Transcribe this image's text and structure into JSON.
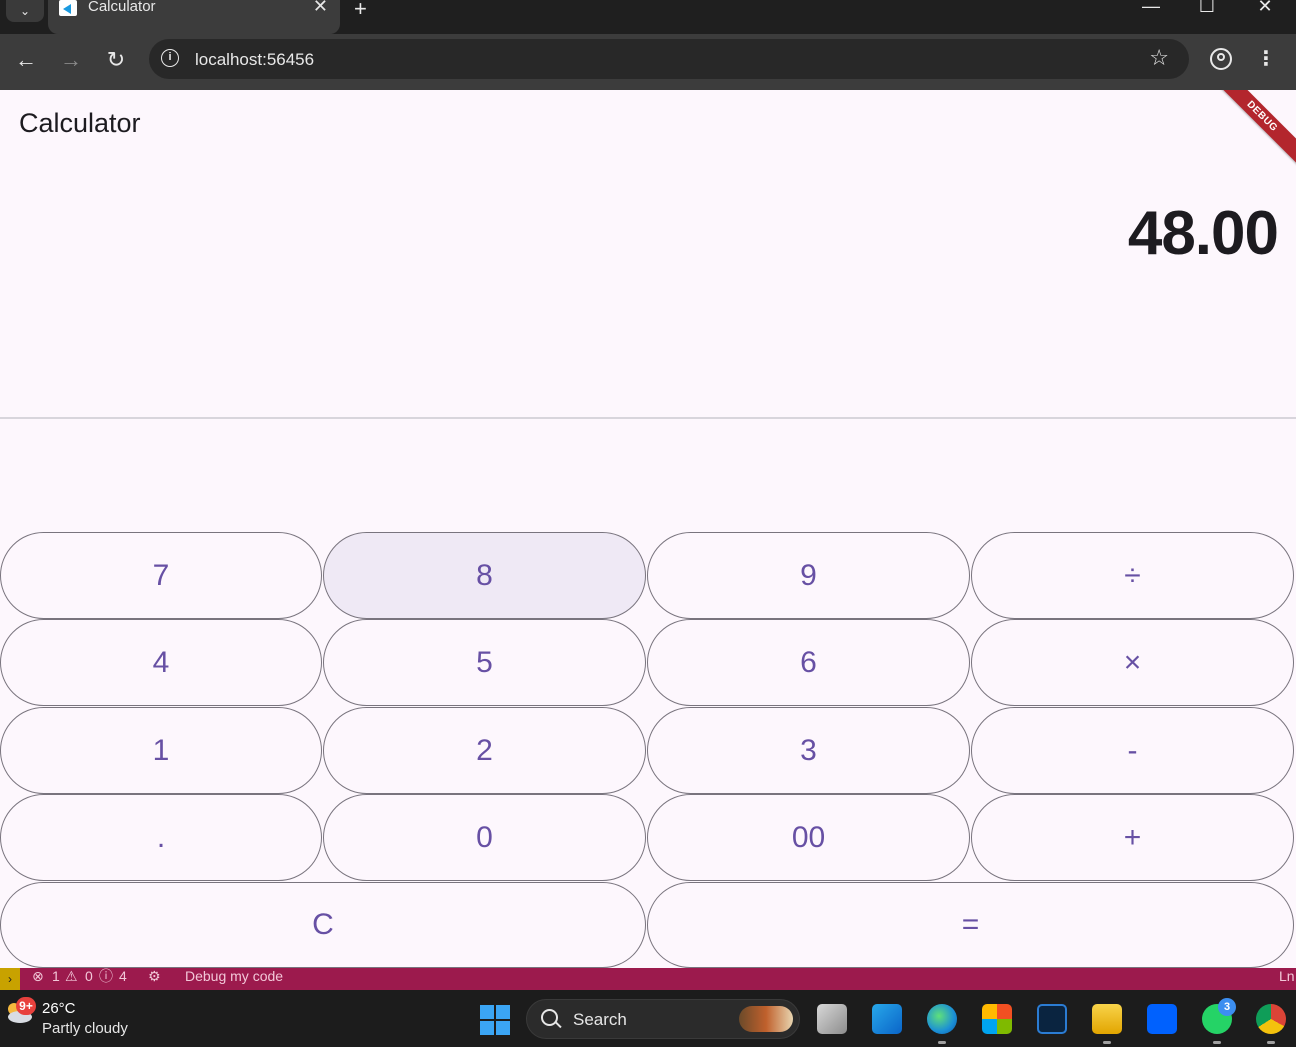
{
  "browser": {
    "tab_title": "Calculator",
    "tab_close": "✕",
    "new_tab": "+",
    "url": "localhost:56456",
    "window_controls": {
      "minimize": "—",
      "maximize": "☐",
      "close": "✕"
    },
    "icons": [
      "tab-dropdown-icon",
      "flutter-favicon-icon",
      "back-arrow-icon",
      "forward-arrow-icon",
      "reload-icon",
      "site-info-icon",
      "bookmark-star-icon",
      "profile-icon",
      "kebab-menu-icon"
    ]
  },
  "app": {
    "title": "Calculator",
    "debug_banner": "DEBUG",
    "display": "48.00",
    "colors": {
      "background": "#fdf7fd",
      "accent": "#6750a4",
      "outline": "#79747e",
      "hover": "#efe9f5",
      "debug": "#b3262d"
    },
    "keys": {
      "k7": "7",
      "k8": "8",
      "k9": "9",
      "divide": "÷",
      "k4": "4",
      "k5": "5",
      "k6": "6",
      "multiply": "×",
      "k1": "1",
      "k2": "2",
      "k3": "3",
      "minus": "-",
      "dot": ".",
      "k0": "0",
      "k00": "00",
      "plus": "+",
      "clear": "C",
      "equals": "="
    },
    "hovered_key": "8"
  },
  "statusbar": {
    "errors": "1",
    "warnings": "0",
    "infos": "4",
    "debug_label": "Debug my code",
    "position_hint": "Ln",
    "color": "#9c1a4d"
  },
  "taskbar": {
    "weather_badge": "9+",
    "temperature": "26°C",
    "condition": "Partly cloudy",
    "search_label": "Search",
    "whatsapp_badge": "3",
    "icons": [
      "windows-start-icon",
      "task-view-icon",
      "outlook-icon",
      "edge-icon",
      "microsoft-store-icon",
      "shield-app-icon",
      "file-explorer-icon",
      "dropbox-icon",
      "whatsapp-icon",
      "chrome-icon"
    ]
  }
}
